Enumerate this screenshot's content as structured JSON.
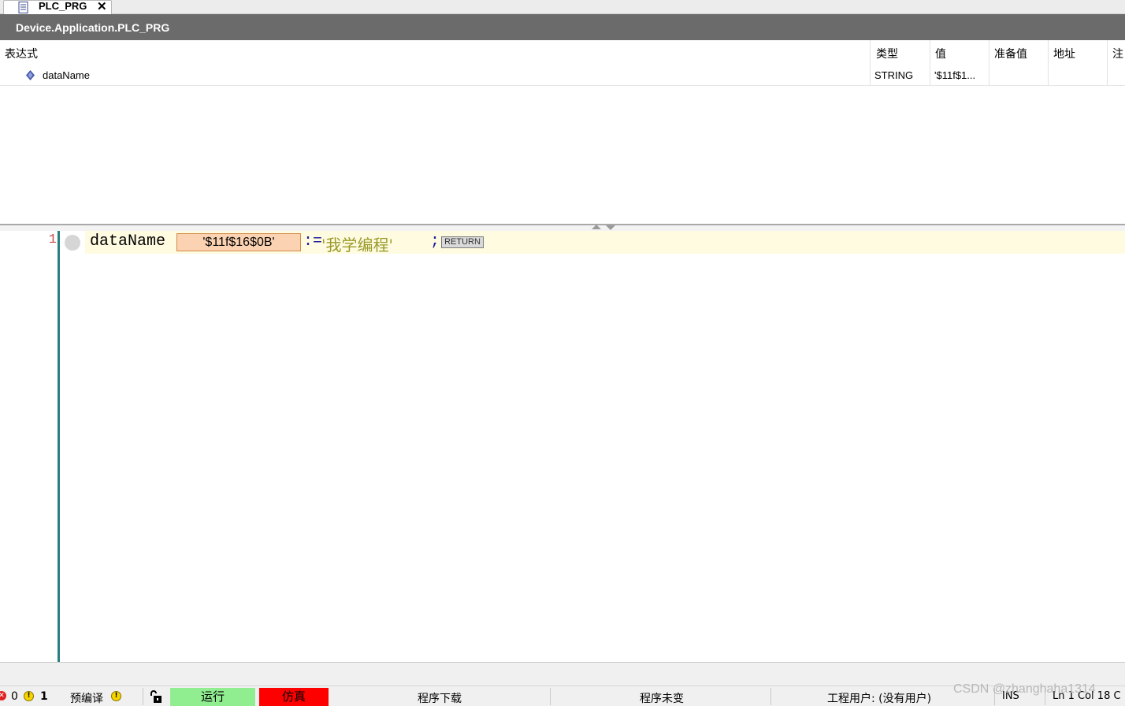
{
  "tab": {
    "label": "PLC_PRG",
    "close": "✕"
  },
  "path": {
    "title": "Device.Application.PLC_PRG"
  },
  "watch": {
    "headers": {
      "expression": "表达式",
      "type": "类型",
      "value": "值",
      "prepared_value": "准备值",
      "address": "地址",
      "comment": "注"
    },
    "rows": [
      {
        "expression": "dataName",
        "type": "STRING",
        "value": "'$11f$1..."
      }
    ]
  },
  "editor": {
    "line_number": "1",
    "variable": "dataName",
    "inline_value": "'$11f$16$0B'",
    "operator": ":=",
    "string_literal": "'我学编程'",
    "semicolon": ";",
    "return_label": "RETURN"
  },
  "status": {
    "error_count": "0",
    "warning_count": "1",
    "precompile": "预编译",
    "run": "运行",
    "simulation": "仿真",
    "download": "程序下载",
    "unchanged": "程序未变",
    "project_user": "工程用户: (没有用户)",
    "ins": "INS",
    "position": "Ln 1  Col 18  C"
  },
  "watermark": "CSDN @zhanghaha1314",
  "colors": {
    "run_bg": "#90ee90",
    "sim_bg": "#ff0000",
    "inline_value_bg": "#fcd3b2",
    "path_bar_bg": "#6b6b6b",
    "gutter_line": "#2a8080"
  }
}
